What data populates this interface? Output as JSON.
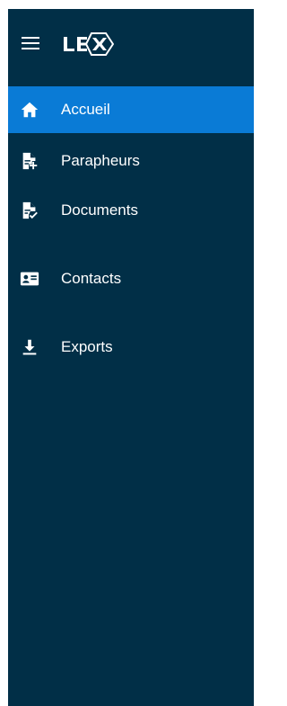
{
  "app": {
    "logo_text": "LEX",
    "colors": {
      "sidebar_bg": "#012f47",
      "active_bg": "#0a7bd6",
      "text": "#ffffff"
    }
  },
  "header": {
    "menu_icon": "hamburger-menu-icon"
  },
  "nav": {
    "items": [
      {
        "label": "Accueil",
        "icon": "home-icon",
        "active": true
      },
      {
        "label": "Parapheurs",
        "icon": "document-add-icon",
        "active": false
      },
      {
        "label": "Documents",
        "icon": "document-check-icon",
        "active": false
      },
      {
        "label": "Contacts",
        "icon": "contact-card-icon",
        "active": false
      },
      {
        "label": "Exports",
        "icon": "download-icon",
        "active": false
      }
    ]
  }
}
